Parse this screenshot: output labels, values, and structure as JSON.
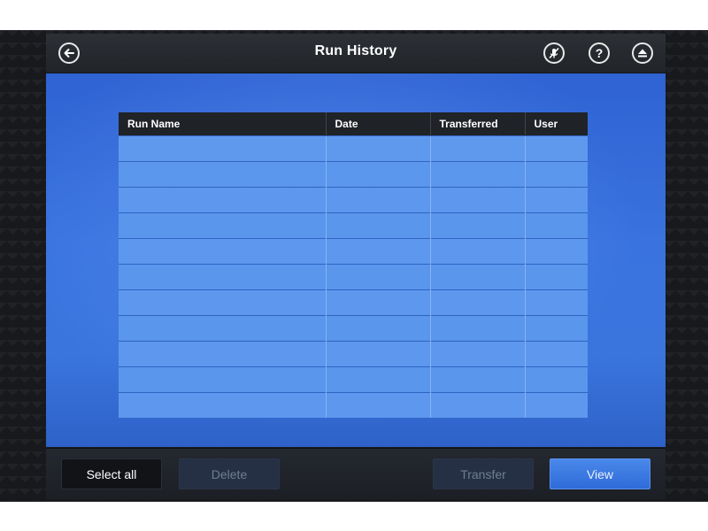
{
  "header": {
    "title": "Run History",
    "back_icon": "back-arrow-icon",
    "mute_icon": "microphone-muted-icon",
    "help_icon": "help-icon",
    "eject_icon": "eject-icon"
  },
  "table": {
    "columns": [
      "Run Name",
      "Date",
      "Transferred",
      "User"
    ],
    "rows": [
      [
        "",
        "",
        "",
        ""
      ],
      [
        "",
        "",
        "",
        ""
      ],
      [
        "",
        "",
        "",
        ""
      ],
      [
        "",
        "",
        "",
        ""
      ],
      [
        "",
        "",
        "",
        ""
      ],
      [
        "",
        "",
        "",
        ""
      ],
      [
        "",
        "",
        "",
        ""
      ],
      [
        "",
        "",
        "",
        ""
      ],
      [
        "",
        "",
        "",
        ""
      ],
      [
        "",
        "",
        "",
        ""
      ],
      [
        "",
        "",
        "",
        ""
      ]
    ]
  },
  "footer": {
    "select_all_label": "Select all",
    "delete_label": "Delete",
    "transfer_label": "Transfer",
    "view_label": "View"
  },
  "colors": {
    "content_blue": "#3a73df",
    "row_blue": "#5a96ec",
    "header_dark": "#1c1f24",
    "primary_button": "#3a78e2"
  }
}
